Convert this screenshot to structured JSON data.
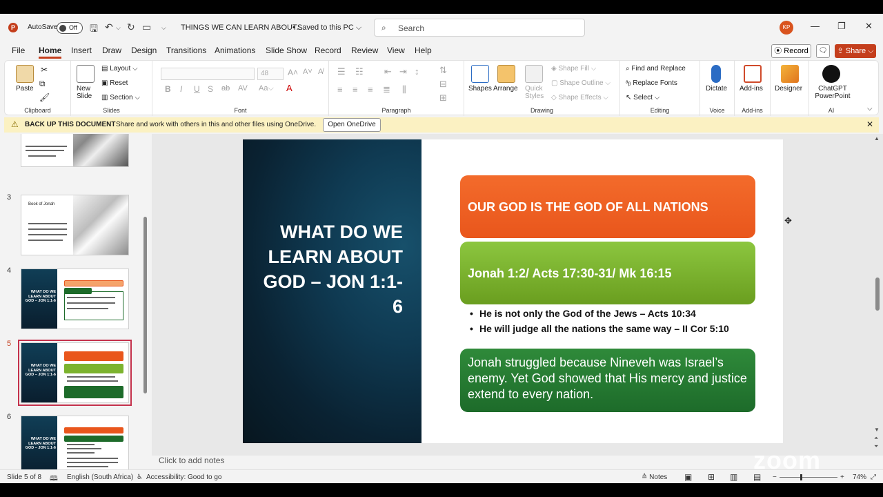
{
  "titlebar": {
    "autosave_label": "AutoSave",
    "autosave_state": "Off",
    "doc_title": "THINGS WE CAN LEARN ABOUT...",
    "saved_status": "• Saved to this PC ⌵",
    "search_placeholder": "Search",
    "user_initials": "KP"
  },
  "menu": {
    "tabs": [
      "File",
      "Home",
      "Insert",
      "Draw",
      "Design",
      "Transitions",
      "Animations",
      "Slide Show",
      "Record",
      "Review",
      "View",
      "Help"
    ],
    "record_label": "Record",
    "share_label": "Share"
  },
  "ribbon": {
    "clipboard": {
      "paste": "Paste",
      "label": "Clipboard"
    },
    "slides": {
      "new_slide": "New Slide",
      "layout": "Layout",
      "reset": "Reset",
      "section": "Section",
      "label": "Slides"
    },
    "font": {
      "size": "48",
      "label": "Font"
    },
    "paragraph": {
      "label": "Paragraph"
    },
    "drawing": {
      "shapes": "Shapes",
      "arrange": "Arrange",
      "quick_styles": "Quick Styles",
      "shape_fill": "Shape Fill",
      "shape_outline": "Shape Outline",
      "shape_effects": "Shape Effects",
      "label": "Drawing"
    },
    "editing": {
      "find_replace": "Find and Replace",
      "replace_fonts": "Replace Fonts",
      "select": "Select",
      "label": "Editing"
    },
    "voice": {
      "dictate": "Dictate",
      "label": "Voice"
    },
    "addins": {
      "addins": "Add-ins",
      "label": "Add-ins"
    },
    "designer": {
      "designer": "Designer"
    },
    "ai": {
      "chatgpt": "ChatGPT PowerPoint",
      "label": "AI"
    }
  },
  "notice": {
    "title": "BACK UP THIS DOCUMENT",
    "message": "Share and work with others in this and other files using OneDrive.",
    "button": "Open OneDrive"
  },
  "thumbnails": {
    "n3": "3",
    "n4": "4",
    "n5": "5",
    "n6": "6",
    "slide3_heading": "Book of Jonah",
    "dark_title": "WHAT DO WE LEARN ABOUT GOD – JON 1:1-6"
  },
  "slide": {
    "title": "WHAT DO WE LEARN ABOUT GOD – JON 1:1-6",
    "box1": "OUR GOD IS THE GOD OF ALL NATIONS",
    "box2": "Jonah 1:2/ Acts 17:30-31/ Mk 16:15",
    "bullet1": "He is not only the God of the Jews – Acts 10:34",
    "bullet2": "He will judge all the nations the same way – II Cor 5:10",
    "box3": "Jonah struggled because Nineveh was Israel’s enemy. Yet God showed that His mercy and justice extend to every nation."
  },
  "notes_placeholder": "Click to add notes",
  "status": {
    "slide_counter": "Slide 5 of 8",
    "language": "English (South Africa)",
    "accessibility": "Accessibility: Good to go",
    "notes": "Notes",
    "zoom": "74%"
  },
  "watermark": "zoom"
}
